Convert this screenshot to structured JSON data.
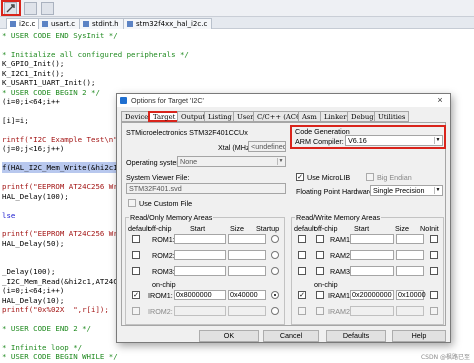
{
  "tabs": [
    "i2c.c",
    "usart.c",
    "stdint.h",
    "stm32f4xx_hal_i2c.c"
  ],
  "code_lines": [
    {
      "text": "* USER CODE END SysInit */",
      "cls": "cm"
    },
    {
      "text": "",
      "cls": ""
    },
    {
      "text": "* Initialize all configured peripherals */",
      "cls": "cm"
    },
    {
      "text": "K_GPIO_Init();",
      "cls": ""
    },
    {
      "text": "K_I2C1_Init();",
      "cls": ""
    },
    {
      "text": "K_USART1_UART_Init();",
      "cls": ""
    },
    {
      "text": "* USER CODE BEGIN 2 */",
      "cls": "cm"
    },
    {
      "text": "(i=0;i<64;i++",
      "cls": ""
    },
    {
      "text": "",
      "cls": ""
    },
    {
      "text": "[i]=i;",
      "cls": ""
    },
    {
      "text": "",
      "cls": ""
    },
    {
      "text": "rintf(\"I2C Example Test\\n\");",
      "cls": "st"
    },
    {
      "text": "(j=0;j<16;j++)",
      "cls": ""
    },
    {
      "text": "",
      "cls": ""
    },
    {
      "text": "f(HAL_I2C_Mem_Write(&hi2c1,",
      "cls": "hl"
    },
    {
      "text": "",
      "cls": ""
    },
    {
      "text": "printf(\"EEPROM AT24C256 Wr",
      "cls": "st"
    },
    {
      "text": "HAL_Delay(100);",
      "cls": ""
    },
    {
      "text": "",
      "cls": ""
    },
    {
      "text": "lse",
      "cls": "kw"
    },
    {
      "text": "",
      "cls": ""
    },
    {
      "text": "printf(\"EEPROM AT24C256 Wr",
      "cls": "st"
    },
    {
      "text": "HAL_Delay(50);",
      "cls": ""
    },
    {
      "text": "",
      "cls": ""
    },
    {
      "text": "",
      "cls": ""
    },
    {
      "text": "_Delay(100);",
      "cls": ""
    },
    {
      "text": "_I2C_Mem_Read(&hi2c1,AT24C2",
      "cls": ""
    },
    {
      "text": "(i=0;i<64;i++)",
      "cls": ""
    },
    {
      "text": "HAL_Delay(10);",
      "cls": ""
    },
    {
      "text": "printf(\"0x%02X  \",r[i]);",
      "cls": "st"
    },
    {
      "text": "",
      "cls": ""
    },
    {
      "text": "* USER CODE END 2 */",
      "cls": "cm"
    },
    {
      "text": "",
      "cls": ""
    },
    {
      "text": "* Infinite loop */",
      "cls": "cm"
    },
    {
      "text": "* USER CODE BEGIN WHILE */",
      "cls": "cm"
    }
  ],
  "dialog": {
    "title": "Options for Target 'I2C'",
    "close": "×",
    "tabs": [
      "Device",
      "Target",
      "Output",
      "Listing",
      "User",
      "C/C++ (AC6)",
      "Asm",
      "Linker",
      "Debug",
      "Utilities"
    ],
    "active_tab": "Target",
    "device_name": "STMicroelectronics STM32F401CCUx",
    "xtal_label": "Xtal (MHz):",
    "xtal_value": "<undefined>",
    "os_label": "Operating system:",
    "os_value": "None",
    "sv_label": "System Viewer File:",
    "sv_value": "STM32F401.svd",
    "custom_file_label": "Use Custom File",
    "code_gen_title": "Code Generation",
    "arm_compiler_label": "ARM Compiler:",
    "arm_compiler_value": "V6.16",
    "microlib_label": "Use MicroLIB",
    "big_endian_label": "Big Endian",
    "fp_label": "Floating Point Hardware:",
    "fp_value": "Single Precision",
    "rom_title": "Read/Only Memory Areas",
    "ram_title": "Read/Write Memory Areas",
    "col_default": "default",
    "col_offchip": "off-chip",
    "col_start": "Start",
    "col_size": "Size",
    "col_startup": "Startup",
    "col_noinit": "NoInit",
    "rom_rows": [
      "ROM1:",
      "ROM2:",
      "ROM3:"
    ],
    "ram_rows": [
      "RAM1:",
      "RAM2:",
      "RAM3:"
    ],
    "on_chip": "on-chip",
    "irom1_label": "IROM1:",
    "irom1_start": "0x8000000",
    "irom1_size": "0x40000",
    "irom2_label": "IROM2:",
    "iram1_label": "IRAM1:",
    "iram1_start": "0x20000000",
    "iram1_size": "0x10000",
    "iram2_label": "IRAM2:",
    "buttons": {
      "ok": "OK",
      "cancel": "Cancel",
      "defaults": "Defaults",
      "help": "Help"
    }
  },
  "watermark": "CSDN @枫路已至",
  "colors": {
    "highlight_red": "#d9241b",
    "code_comment": "#1f8a1f"
  }
}
